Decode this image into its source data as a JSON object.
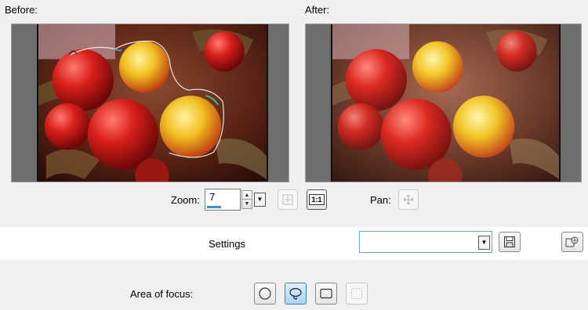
{
  "preview": {
    "before_label": "Before:",
    "after_label": "After:"
  },
  "zoom": {
    "label": "Zoom:",
    "value": "7",
    "fit_icon": "fit-to-window-icon",
    "actual_size_label": "1:1"
  },
  "pan": {
    "label": "Pan:",
    "icon": "pan-move-icon"
  },
  "settings": {
    "label": "Settings",
    "value": "",
    "save_icon": "floppy-disk-icon",
    "manage_icon": "settings-manager-icon"
  },
  "area_of_focus": {
    "label": "Area of focus:",
    "tools": [
      {
        "name": "ellipse-selection",
        "icon": "circle-icon",
        "active": false
      },
      {
        "name": "freehand-selection",
        "icon": "lasso-icon",
        "active": true
      },
      {
        "name": "rectangle-selection",
        "icon": "rectangle-icon",
        "active": false
      },
      {
        "name": "clear-selection",
        "icon": "clear-selection-icon",
        "active": false
      }
    ]
  },
  "colors": {
    "panel_bg": "#f0f0f0",
    "accent": "#3b8ee8",
    "active_tool": "#a9d5f2"
  }
}
